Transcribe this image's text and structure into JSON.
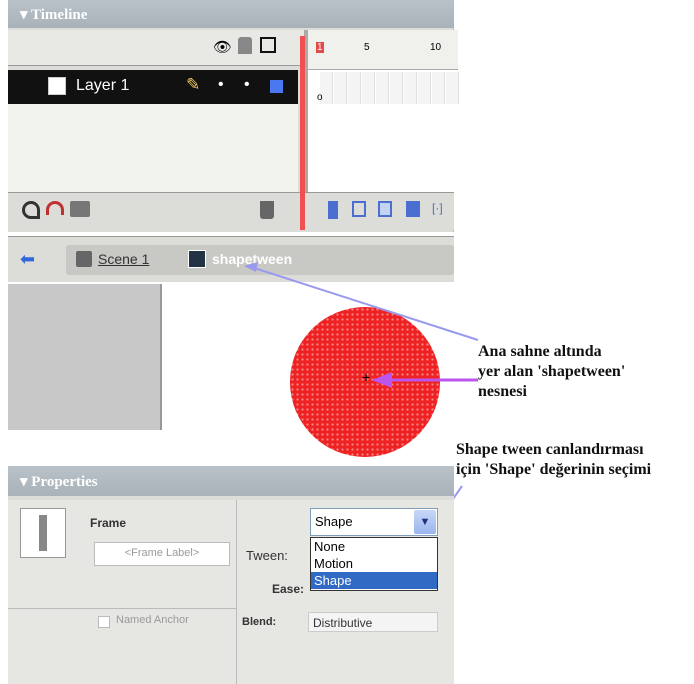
{
  "timeline": {
    "title": "Timeline",
    "layer_name": "Layer 1",
    "frame_numbers": [
      "1",
      "5",
      "10"
    ]
  },
  "editbar": {
    "scene_link": "Scene 1",
    "symbol_name": "shapetween"
  },
  "annotations": {
    "note1": [
      "Ana sahne altında",
      "yer alan 'shapetween'",
      "nesnesi"
    ],
    "note2": [
      "Shape tween canlandırması",
      "için 'Shape' değerinin seçimi"
    ]
  },
  "properties": {
    "title": "Properties",
    "frame_label": "Frame",
    "frame_label_placeholder": "<Frame Label>",
    "tween_label": "Tween:",
    "tween_value": "Shape",
    "tween_options": [
      "None",
      "Motion",
      "Shape"
    ],
    "ease_label": "Ease:",
    "named_anchor_label": "Named Anchor",
    "blend_label": "Blend:",
    "blend_value": "Distributive"
  },
  "colors": {
    "circle_fill": "#ee2222",
    "arrow_color": "#9999ee",
    "selection": "#316ac5"
  }
}
